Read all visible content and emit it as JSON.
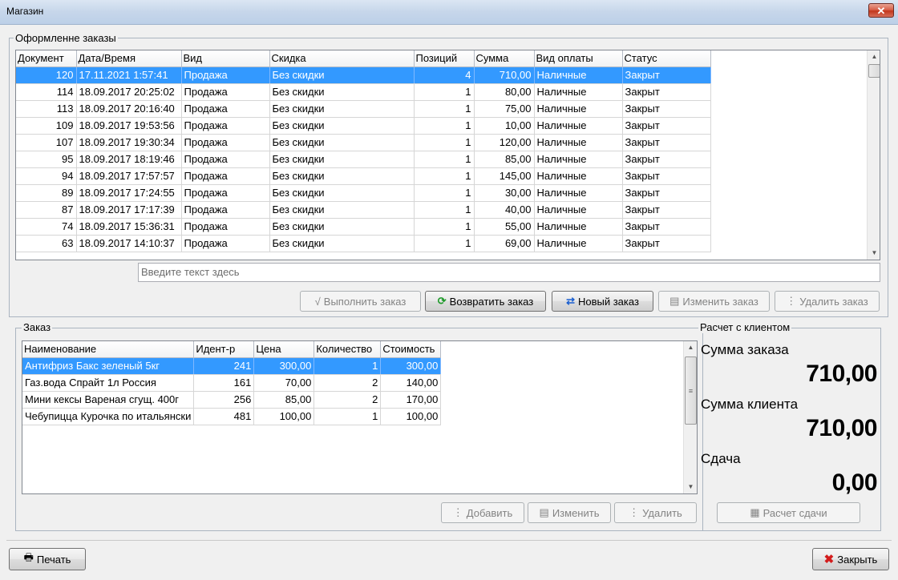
{
  "window": {
    "title": "Магазин",
    "close_glyph": "✕",
    "close_icon": "close-icon"
  },
  "orders_group": {
    "title": "Оформленне заказы",
    "columns": [
      "Документ",
      "Дата/Время",
      "Вид",
      "Скидка",
      "Позиций",
      "Сумма",
      "Вид оплаты",
      "Статус"
    ],
    "rows": [
      [
        "120",
        "17.11.2021 1:57:41",
        "Продажа",
        "Без скидки",
        "4",
        "710,00",
        "Наличные",
        "Закрыт"
      ],
      [
        "114",
        "18.09.2017 20:25:02",
        "Продажа",
        "Без скидки",
        "1",
        "80,00",
        "Наличные",
        "Закрыт"
      ],
      [
        "113",
        "18.09.2017 20:16:40",
        "Продажа",
        "Без скидки",
        "1",
        "75,00",
        "Наличные",
        "Закрыт"
      ],
      [
        "109",
        "18.09.2017 19:53:56",
        "Продажа",
        "Без скидки",
        "1",
        "10,00",
        "Наличные",
        "Закрыт"
      ],
      [
        "107",
        "18.09.2017 19:30:34",
        "Продажа",
        "Без скидки",
        "1",
        "120,00",
        "Наличные",
        "Закрыт"
      ],
      [
        "95",
        "18.09.2017 18:19:46",
        "Продажа",
        "Без скидки",
        "1",
        "85,00",
        "Наличные",
        "Закрыт"
      ],
      [
        "94",
        "18.09.2017 17:57:57",
        "Продажа",
        "Без скидки",
        "1",
        "145,00",
        "Наличные",
        "Закрыт"
      ],
      [
        "89",
        "18.09.2017 17:24:55",
        "Продажа",
        "Без скидки",
        "1",
        "30,00",
        "Наличные",
        "Закрыт"
      ],
      [
        "87",
        "18.09.2017 17:17:39",
        "Продажа",
        "Без скидки",
        "1",
        "40,00",
        "Наличные",
        "Закрыт"
      ],
      [
        "74",
        "18.09.2017 15:36:31",
        "Продажа",
        "Без скидки",
        "1",
        "55,00",
        "Наличные",
        "Закрыт"
      ],
      [
        "63",
        "18.09.2017 14:10:37",
        "Продажа",
        "Без скидки",
        "1",
        "69,00",
        "Наличные",
        "Закрыт"
      ]
    ],
    "selected_row": 0,
    "search_placeholder": "Введите текст здесь",
    "buttons": {
      "complete": "Выполнить заказ",
      "return": "Возвратить заказ",
      "new": "Новый заказ",
      "edit": "Изменить заказ",
      "delete": "Удалить заказ"
    }
  },
  "order_group": {
    "title": "Заказ",
    "columns": [
      "Наименование",
      "Идент-р",
      "Цена",
      "Количество",
      "Стоимость"
    ],
    "rows": [
      [
        "Антифриз Бакс зеленый 5кг",
        "241",
        "300,00",
        "1",
        "300,00"
      ],
      [
        "Газ.вода Спрайт 1л Россия",
        "161",
        "70,00",
        "2",
        "140,00"
      ],
      [
        "Мини кексы Вареная сгущ. 400г",
        "256",
        "85,00",
        "2",
        "170,00"
      ],
      [
        "Чебупицца Курочка по итальянски",
        "481",
        "100,00",
        "1",
        "100,00"
      ]
    ],
    "selected_row": 0,
    "buttons": {
      "add": "Добавить",
      "edit": "Изменить",
      "delete": "Удалить"
    }
  },
  "calc_group": {
    "title": "Расчет с клиентом",
    "order_sum_label": "Сумма заказа",
    "order_sum": "710,00",
    "client_sum_label": "Сумма клиента",
    "client_sum": "710,00",
    "change_label": "Сдача",
    "change": "0,00",
    "calc_button": "Расчет сдачи"
  },
  "footer": {
    "print": "Печать",
    "close": "Закрыть"
  },
  "colors": {
    "selection": "#3399ff",
    "title_bar": "#c6d6ea",
    "close_red": "#c2371c"
  }
}
